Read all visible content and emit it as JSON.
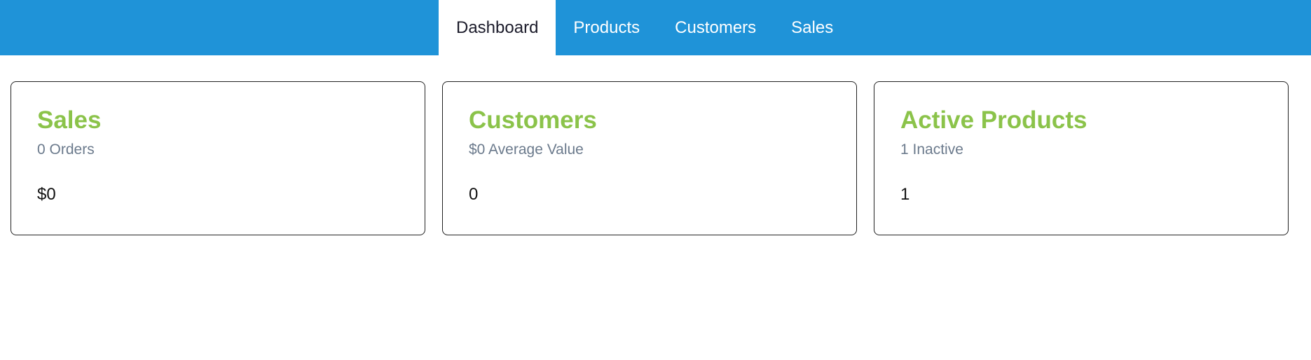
{
  "colors": {
    "navbar_bg": "#1f93d8",
    "card_title": "#8bc34a",
    "card_subtitle": "#6b7a8c"
  },
  "nav": {
    "tabs": [
      {
        "label": "Dashboard",
        "active": true
      },
      {
        "label": "Products",
        "active": false
      },
      {
        "label": "Customers",
        "active": false
      },
      {
        "label": "Sales",
        "active": false
      }
    ]
  },
  "cards": [
    {
      "title": "Sales",
      "subtitle": "0 Orders",
      "value": "$0"
    },
    {
      "title": "Customers",
      "subtitle": "$0 Average Value",
      "value": "0"
    },
    {
      "title": "Active Products",
      "subtitle": "1 Inactive",
      "value": "1"
    }
  ]
}
